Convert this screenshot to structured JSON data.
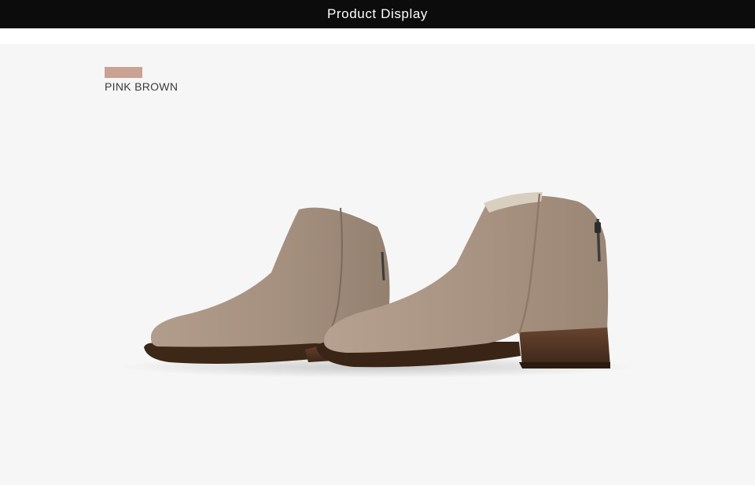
{
  "header": {
    "title": "Product Display"
  },
  "swatch": {
    "label": "PINK BROWN",
    "color": "#c9a294"
  },
  "colors": {
    "header_bg": "#0c0c0c",
    "photo_bg": "#f6f6f6",
    "suede": "#a38f80",
    "sole": "#4a3222"
  },
  "image": {
    "subject": "pair-of-suede-ankle-boots-icon"
  }
}
